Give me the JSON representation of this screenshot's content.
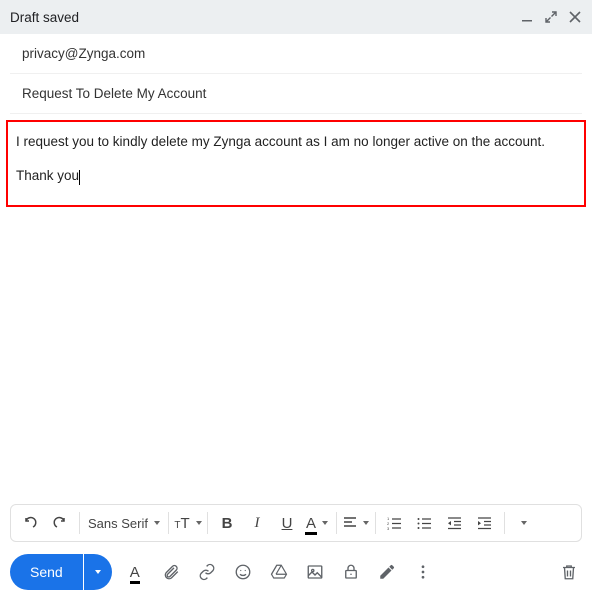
{
  "header": {
    "title": "Draft saved"
  },
  "to": "privacy@Zynga.com",
  "subject": "Request To Delete My Account",
  "body": {
    "line1": "I request you to kindly delete my Zynga account as I am no longer active on the account.",
    "line2": "Thank you"
  },
  "toolbar": {
    "font": "Sans Serif",
    "bold": "B",
    "italic": "I",
    "underline": "U",
    "color": "A",
    "textsize_big": "T",
    "textsize_small": "T"
  },
  "actions": {
    "send": "Send",
    "format_A": "A"
  }
}
